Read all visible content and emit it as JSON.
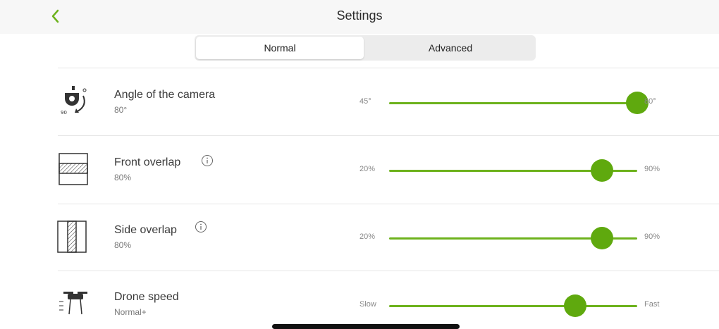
{
  "header": {
    "title": "Settings",
    "accent": "#6db21c"
  },
  "tabs": [
    {
      "label": "Normal",
      "active": true
    },
    {
      "label": "Advanced",
      "active": false
    }
  ],
  "settings": [
    {
      "label": "Angle of the camera",
      "value": "80°",
      "min_label": "45°",
      "max_label": "80°",
      "level": 1.0,
      "icon": "camera-angle-icon",
      "info": false
    },
    {
      "label": "Front overlap",
      "value": "80%",
      "min_label": "20%",
      "max_label": "90%",
      "level": 0.857,
      "icon": "front-overlap-icon",
      "info": true
    },
    {
      "label": "Side overlap",
      "value": "80%",
      "min_label": "20%",
      "max_label": "90%",
      "level": 0.857,
      "icon": "side-overlap-icon",
      "info": true
    },
    {
      "label": "Drone speed",
      "value": "Normal+",
      "min_label": "Slow",
      "max_label": "Fast",
      "level": 0.75,
      "icon": "drone-icon",
      "info": false
    }
  ]
}
